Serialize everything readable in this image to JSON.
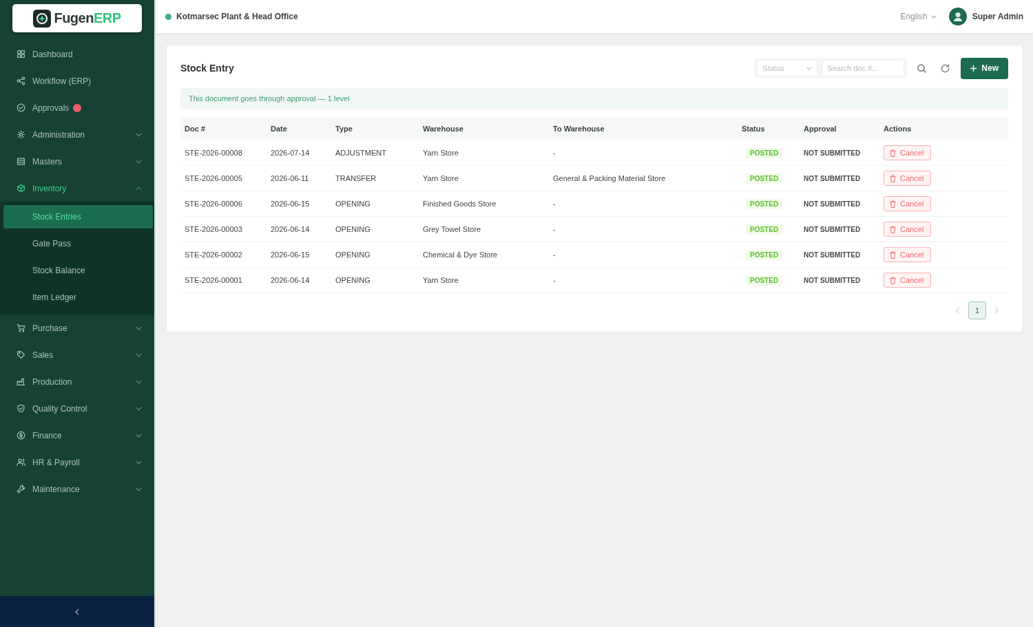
{
  "sidebar": {
    "logo": {
      "name": "Fugen",
      "suffix": "ERP"
    },
    "items": [
      {
        "label": "Dashboard",
        "kind": "link",
        "selected": false
      },
      {
        "label": "Workflow (ERP)",
        "kind": "link",
        "selected": false
      },
      {
        "label": "Approvals",
        "kind": "link",
        "selected": false,
        "notification": true
      },
      {
        "label": "Administration",
        "kind": "group",
        "selected": false,
        "expanded": false
      },
      {
        "label": "Masters",
        "kind": "group",
        "selected": false,
        "expanded": false
      },
      {
        "label": "Inventory",
        "kind": "group",
        "selected": true,
        "expanded": true,
        "children": [
          {
            "label": "Stock Entries",
            "selected": true
          },
          {
            "label": "Gate Pass",
            "selected": false
          },
          {
            "label": "Stock Balance",
            "selected": false
          },
          {
            "label": "Item Ledger",
            "selected": false
          }
        ]
      },
      {
        "label": "Purchase",
        "kind": "group",
        "selected": false,
        "expanded": false
      },
      {
        "label": "Sales",
        "kind": "group",
        "selected": false,
        "expanded": false
      },
      {
        "label": "Production",
        "kind": "group",
        "selected": false,
        "expanded": false
      },
      {
        "label": "Quality Control",
        "kind": "group",
        "selected": false,
        "expanded": false
      },
      {
        "label": "Finance",
        "kind": "group",
        "selected": false,
        "expanded": false
      },
      {
        "label": "HR & Payroll",
        "kind": "group",
        "selected": false,
        "expanded": false
      },
      {
        "label": "Maintenance",
        "kind": "group",
        "selected": false,
        "expanded": false
      }
    ]
  },
  "header": {
    "location": "Kotmarsec Plant & Head Office",
    "language": "English",
    "user": "Super Admin"
  },
  "page": {
    "title": "Stock Entry",
    "status_filter": {
      "placeholder": "Status"
    },
    "search": {
      "placeholder": "Search doc #..."
    },
    "new_button": "New",
    "notice": "This document goes through approval — 1 level"
  },
  "table": {
    "columns": [
      "Doc #",
      "Date",
      "Type",
      "Warehouse",
      "To Warehouse",
      "Status",
      "Approval",
      "Actions"
    ],
    "rows": [
      {
        "doc": "STE-2026-00008",
        "date": "2026-07-14",
        "type": "ADJUSTMENT",
        "warehouse": "Yarn Store",
        "to_warehouse": "-",
        "status": "POSTED",
        "approval": "NOT SUBMITTED",
        "action": "Cancel"
      },
      {
        "doc": "STE-2026-00005",
        "date": "2026-06-11",
        "type": "TRANSFER",
        "warehouse": "Yarn Store",
        "to_warehouse": "General & Packing Material Store",
        "status": "POSTED",
        "approval": "NOT SUBMITTED",
        "action": "Cancel"
      },
      {
        "doc": "STE-2026-00006",
        "date": "2026-06-15",
        "type": "OPENING",
        "warehouse": "Finished Goods Store",
        "to_warehouse": "-",
        "status": "POSTED",
        "approval": "NOT SUBMITTED",
        "action": "Cancel"
      },
      {
        "doc": "STE-2026-00003",
        "date": "2026-06-14",
        "type": "OPENING",
        "warehouse": "Grey Towel Store",
        "to_warehouse": "-",
        "status": "POSTED",
        "approval": "NOT SUBMITTED",
        "action": "Cancel"
      },
      {
        "doc": "STE-2026-00002",
        "date": "2026-06-15",
        "type": "OPENING",
        "warehouse": "Chemical & Dye Store",
        "to_warehouse": "-",
        "status": "POSTED",
        "approval": "NOT SUBMITTED",
        "action": "Cancel"
      },
      {
        "doc": "STE-2026-00001",
        "date": "2026-06-14",
        "type": "OPENING",
        "warehouse": "Yarn Store",
        "to_warehouse": "-",
        "status": "POSTED",
        "approval": "NOT SUBMITTED",
        "action": "Cancel"
      }
    ]
  },
  "pagination": {
    "pages": [
      {
        "label": "1",
        "selected": true
      }
    ],
    "prev_disabled": true,
    "next_disabled": true
  }
}
